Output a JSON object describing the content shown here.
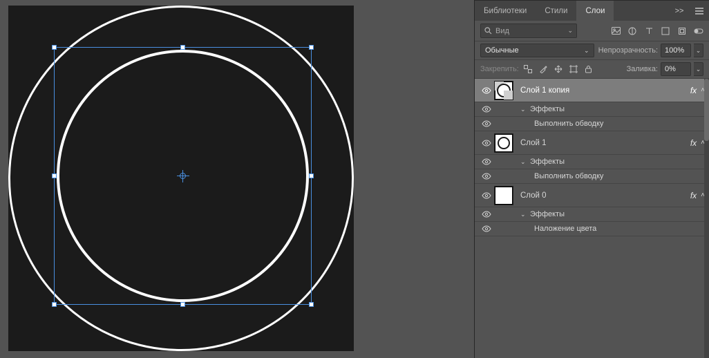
{
  "panel": {
    "tabs": {
      "libraries": "Библиотеки",
      "styles": "Стили",
      "layers": "Слои"
    },
    "collapse_tooltip": ">>",
    "search": {
      "placeholder": "Вид"
    },
    "blend": {
      "mode": "Обычные",
      "opacity_label": "Непрозрачность:",
      "opacity_value": "100%"
    },
    "lock": {
      "label": "Закрепить:",
      "fill_label": "Заливка:",
      "fill_value": "0%"
    }
  },
  "layers": [
    {
      "name": "Слой 1 копия",
      "selected": true,
      "thumb_type": "pattern-circle",
      "fx": "fx",
      "effects_label": "Эффекты",
      "effect_items": [
        "Выполнить обводку"
      ]
    },
    {
      "name": "Слой 1",
      "selected": false,
      "thumb_type": "circle",
      "fx": "fx",
      "effects_label": "Эффекты",
      "effect_items": [
        "Выполнить обводку"
      ]
    },
    {
      "name": "Слой 0",
      "selected": false,
      "thumb_type": "solid",
      "fx": "fx",
      "effects_label": "Эффекты",
      "effect_items": [
        "Наложение цвета"
      ]
    }
  ]
}
